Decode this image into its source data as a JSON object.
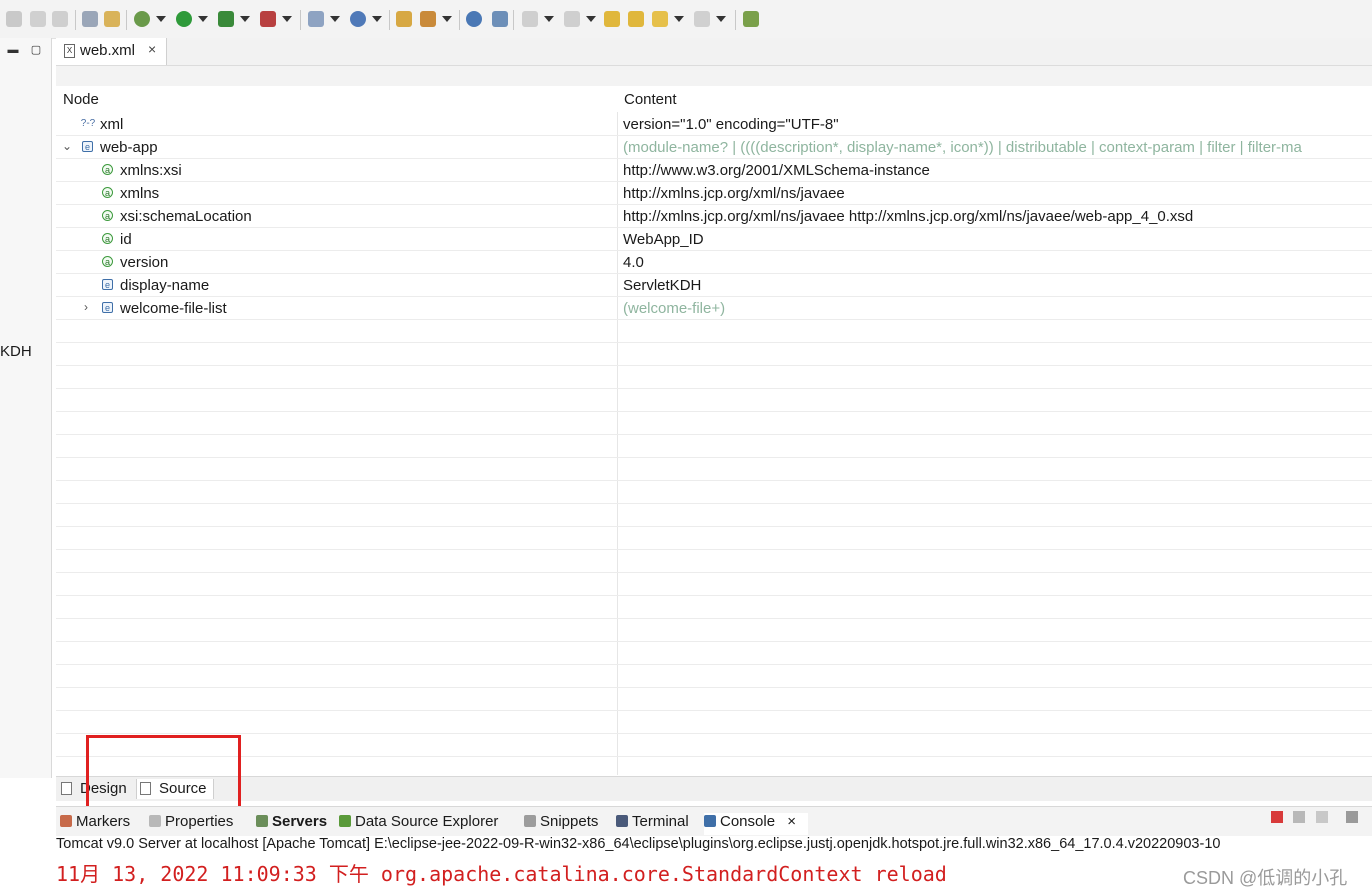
{
  "editor": {
    "tab_title": "web.xml",
    "tab_close": "×",
    "tab_icon": "xml-file-icon"
  },
  "tree": {
    "header_node": "Node",
    "header_content": "Content",
    "rows": [
      {
        "name": "xml",
        "value": "version=\"1.0\" encoding=\"UTF-8\"",
        "icon": "?-?"
      },
      {
        "name": "web-app",
        "value": "(module-name? | ((((description*, display-name*, icon*)) | distributable | context-param | filter | filter-ma",
        "icon": "e"
      },
      {
        "name": "xmlns:xsi",
        "value": "http://www.w3.org/2001/XMLSchema-instance",
        "icon": "a"
      },
      {
        "name": "xmlns",
        "value": "http://xmlns.jcp.org/xml/ns/javaee",
        "icon": "a"
      },
      {
        "name": "xsi:schemaLocation",
        "value": "http://xmlns.jcp.org/xml/ns/javaee http://xmlns.jcp.org/xml/ns/javaee/web-app_4_0.xsd",
        "icon": "a"
      },
      {
        "name": "id",
        "value": "WebApp_ID",
        "icon": "a"
      },
      {
        "name": "version",
        "value": "4.0",
        "icon": "a"
      },
      {
        "name": "display-name",
        "value": "ServletKDH",
        "icon": "e"
      },
      {
        "name": "welcome-file-list",
        "value": "(welcome-file+)",
        "icon": "e"
      }
    ]
  },
  "left_panel": {
    "label": "KDH"
  },
  "editor_bottom_tabs": {
    "design": "Design",
    "source": "Source"
  },
  "views": {
    "markers": "Markers",
    "properties": "Properties",
    "servers": "Servers",
    "data_source_explorer": "Data Source Explorer",
    "snippets": "Snippets",
    "terminal": "Terminal",
    "console": "Console",
    "console_close": "×"
  },
  "console": {
    "header": "Tomcat v9.0 Server at localhost [Apache Tomcat] E:\\eclipse-jee-2022-09-R-win32-x86_64\\eclipse\\plugins\\org.eclipse.justj.openjdk.hotspot.jre.full.win32.x86_64_17.0.4.v20220903-10",
    "line": "11月 13, 2022 11:09:33 下午 org.apache.catalina.core.StandardContext reload"
  },
  "watermark": "CSDN @低调的小孔",
  "colors": {
    "highlight_box": "#e02020",
    "console_error": "#d21f1f",
    "hint_text": "#8fb59f"
  }
}
